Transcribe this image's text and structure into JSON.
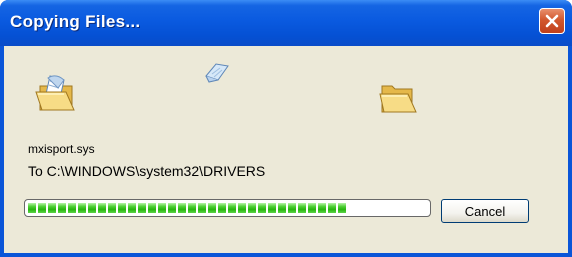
{
  "window": {
    "title": "Copying Files...",
    "close_icon": "close-icon"
  },
  "animation": {
    "source_icon": "open-folder-with-file-icon",
    "flying_icon": "flying-document-icon",
    "destination_icon": "open-folder-icon"
  },
  "file": {
    "name": "mxisport.sys",
    "destination": "To C:\\WINDOWS\\system32\\DRIVERS"
  },
  "progress": {
    "fraction": 0.82
  },
  "buttons": {
    "cancel_label": "Cancel"
  },
  "colors": {
    "titlebar": "#0a5ae0",
    "client_bg": "#ece9d8",
    "close_button": "#d2582e",
    "progress_fill": "#27b50f"
  }
}
